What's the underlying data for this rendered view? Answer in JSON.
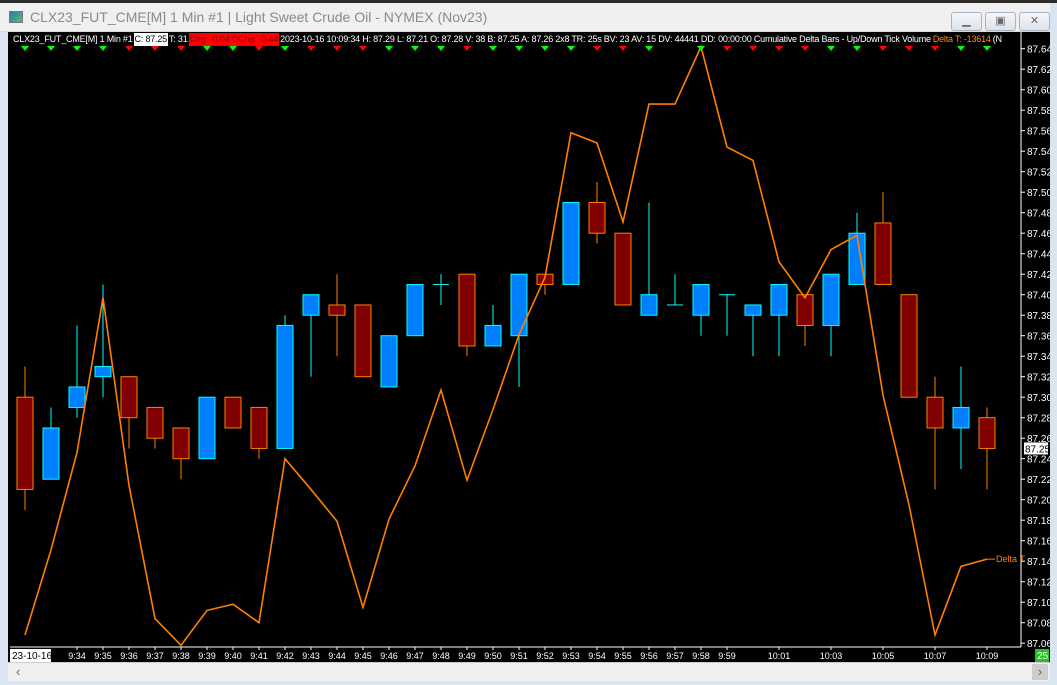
{
  "window": {
    "title": "CLX23_FUT_CME[M]  1 Min  #1 | Light Sweet Crude Oil - NYMEX (Nov23)",
    "minimize_icon": "minimize-icon",
    "restore_icon": "restore-icon",
    "close_icon": "close-icon"
  },
  "infobar": {
    "symbol": "CLX23_FUT_CME[M]  1 Min  #1",
    "close": "C: 87.25",
    "ticks": "T: 31",
    "change": "Chg: -0.04 DChg: -0.44",
    "details": "2023-10-16 10:09:34 H: 87.29 L: 87.21 O: 87.28 V: 38 B: 87.25 A: 87.26 2x8 TR: 25s BV: 23 AV: 15 DV: 44441 DD: 00:00:00 Cumulative Delta Bars - Up/Down Tick Volume",
    "delta": "Delta T: -13614",
    "trailing": "(N"
  },
  "colors": {
    "up_fill": "#0080ff",
    "up_border": "#00ffff",
    "down_fill": "#800000",
    "down_border": "#ff8000",
    "delta_line": "#ff8000",
    "marker_up": "#00ff00",
    "marker_down": "#ff0000"
  },
  "chart_data": {
    "type": "candlestick",
    "ylim": [
      87.055,
      87.655
    ],
    "y_ticks": [
      "87.64",
      "87.62",
      "87.60",
      "87.58",
      "87.56",
      "87.54",
      "87.52",
      "87.50",
      "87.48",
      "87.46",
      "87.44",
      "87.42",
      "87.40",
      "87.38",
      "87.36",
      "87.34",
      "87.32",
      "87.30",
      "87.28",
      "87.26",
      "87.24",
      "87.22",
      "87.20",
      "87.18",
      "87.16",
      "87.14",
      "87.12",
      "87.10",
      "87.08",
      "87.06"
    ],
    "last_price_label": "87.25",
    "date_label": "23-10-16",
    "bar_countdown": "25",
    "x_labels": [
      {
        "i": 2,
        "t": "9:34"
      },
      {
        "i": 3,
        "t": "9:35"
      },
      {
        "i": 4,
        "t": "9:36"
      },
      {
        "i": 5,
        "t": "9:37"
      },
      {
        "i": 6,
        "t": "9:38"
      },
      {
        "i": 7,
        "t": "9:39"
      },
      {
        "i": 8,
        "t": "9:40"
      },
      {
        "i": 9,
        "t": "9:41"
      },
      {
        "i": 10,
        "t": "9:42"
      },
      {
        "i": 11,
        "t": "9:43"
      },
      {
        "i": 12,
        "t": "9:44"
      },
      {
        "i": 13,
        "t": "9:45"
      },
      {
        "i": 14,
        "t": "9:46"
      },
      {
        "i": 15,
        "t": "9:47"
      },
      {
        "i": 16,
        "t": "9:48"
      },
      {
        "i": 17,
        "t": "9:49"
      },
      {
        "i": 18,
        "t": "9:50"
      },
      {
        "i": 19,
        "t": "9:51"
      },
      {
        "i": 20,
        "t": "9:52"
      },
      {
        "i": 21,
        "t": "9:53"
      },
      {
        "i": 22,
        "t": "9:54"
      },
      {
        "i": 23,
        "t": "9:55"
      },
      {
        "i": 24,
        "t": "9:56"
      },
      {
        "i": 25,
        "t": "9:57"
      },
      {
        "i": 26,
        "t": "9:58"
      },
      {
        "i": 27,
        "t": "9:59"
      },
      {
        "i": 29,
        "t": "10:01"
      },
      {
        "i": 31,
        "t": "10:03"
      },
      {
        "i": 33,
        "t": "10:05"
      },
      {
        "i": 35,
        "t": "10:07"
      },
      {
        "i": 37,
        "t": "10:09"
      }
    ],
    "ohlc": [
      [
        87.3,
        87.33,
        87.19,
        87.21
      ],
      [
        87.22,
        87.29,
        87.22,
        87.27
      ],
      [
        87.29,
        87.37,
        87.28,
        87.31
      ],
      [
        87.32,
        87.41,
        87.3,
        87.33
      ],
      [
        87.32,
        87.32,
        87.25,
        87.28
      ],
      [
        87.29,
        87.29,
        87.25,
        87.26
      ],
      [
        87.27,
        87.27,
        87.22,
        87.24
      ],
      [
        87.24,
        87.3,
        87.24,
        87.3
      ],
      [
        87.3,
        87.3,
        87.27,
        87.27
      ],
      [
        87.29,
        87.29,
        87.24,
        87.25
      ],
      [
        87.25,
        87.38,
        87.25,
        87.37
      ],
      [
        87.38,
        87.4,
        87.32,
        87.4
      ],
      [
        87.39,
        87.42,
        87.34,
        87.38
      ],
      [
        87.39,
        87.39,
        87.32,
        87.32
      ],
      [
        87.31,
        87.36,
        87.31,
        87.36
      ],
      [
        87.36,
        87.41,
        87.36,
        87.41
      ],
      [
        87.41,
        87.42,
        87.39,
        87.41
      ],
      [
        87.42,
        87.42,
        87.34,
        87.35
      ],
      [
        87.35,
        87.39,
        87.35,
        87.37
      ],
      [
        87.36,
        87.42,
        87.31,
        87.42
      ],
      [
        87.42,
        87.42,
        87.4,
        87.41
      ],
      [
        87.41,
        87.49,
        87.41,
        87.49
      ],
      [
        87.49,
        87.51,
        87.45,
        87.46
      ],
      [
        87.46,
        87.46,
        87.39,
        87.39
      ],
      [
        87.38,
        87.49,
        87.38,
        87.4
      ],
      [
        87.39,
        87.42,
        87.39,
        87.39
      ],
      [
        87.38,
        87.41,
        87.36,
        87.41
      ],
      [
        87.4,
        87.4,
        87.36,
        87.4
      ],
      [
        87.38,
        87.39,
        87.34,
        87.39
      ],
      [
        87.38,
        87.41,
        87.34,
        87.41
      ],
      [
        87.4,
        87.4,
        87.35,
        87.37
      ],
      [
        87.37,
        87.42,
        87.34,
        87.42
      ],
      [
        87.41,
        87.48,
        87.41,
        87.46
      ],
      [
        87.47,
        87.5,
        87.41,
        87.41
      ],
      [
        87.4,
        87.4,
        87.3,
        87.3
      ],
      [
        87.3,
        87.32,
        87.21,
        87.27
      ],
      [
        87.27,
        87.33,
        87.23,
        87.29
      ],
      [
        87.28,
        87.29,
        87.21,
        87.25
      ]
    ],
    "delta_series_name": "Delta T",
    "delta_on_price_scale": [
      87.068,
      87.151,
      87.246,
      87.397,
      87.214,
      87.084,
      87.058,
      87.092,
      87.098,
      87.08,
      87.24,
      87.21,
      87.179,
      87.095,
      87.181,
      87.233,
      87.307,
      87.219,
      87.288,
      87.361,
      87.417,
      87.558,
      87.548,
      87.471,
      87.586,
      87.586,
      87.642,
      87.544,
      87.531,
      87.432,
      87.397,
      87.444,
      87.458,
      87.302,
      87.195,
      87.068,
      87.135,
      87.142
    ],
    "markers": [
      "up",
      "up",
      "up",
      "up",
      "down",
      "down",
      "down",
      "up",
      "up",
      "down",
      "up",
      "down",
      "down",
      "down",
      "up",
      "up",
      "up",
      "down",
      "up",
      "up",
      "up",
      "up",
      "down",
      "down",
      "up",
      "none",
      "up",
      "down",
      "down",
      "down",
      "down",
      "up",
      "up",
      "down",
      "down",
      "down",
      "up",
      "up"
    ]
  },
  "scrollbar": {
    "left_arrow": "‹",
    "right_arrow": "›"
  }
}
